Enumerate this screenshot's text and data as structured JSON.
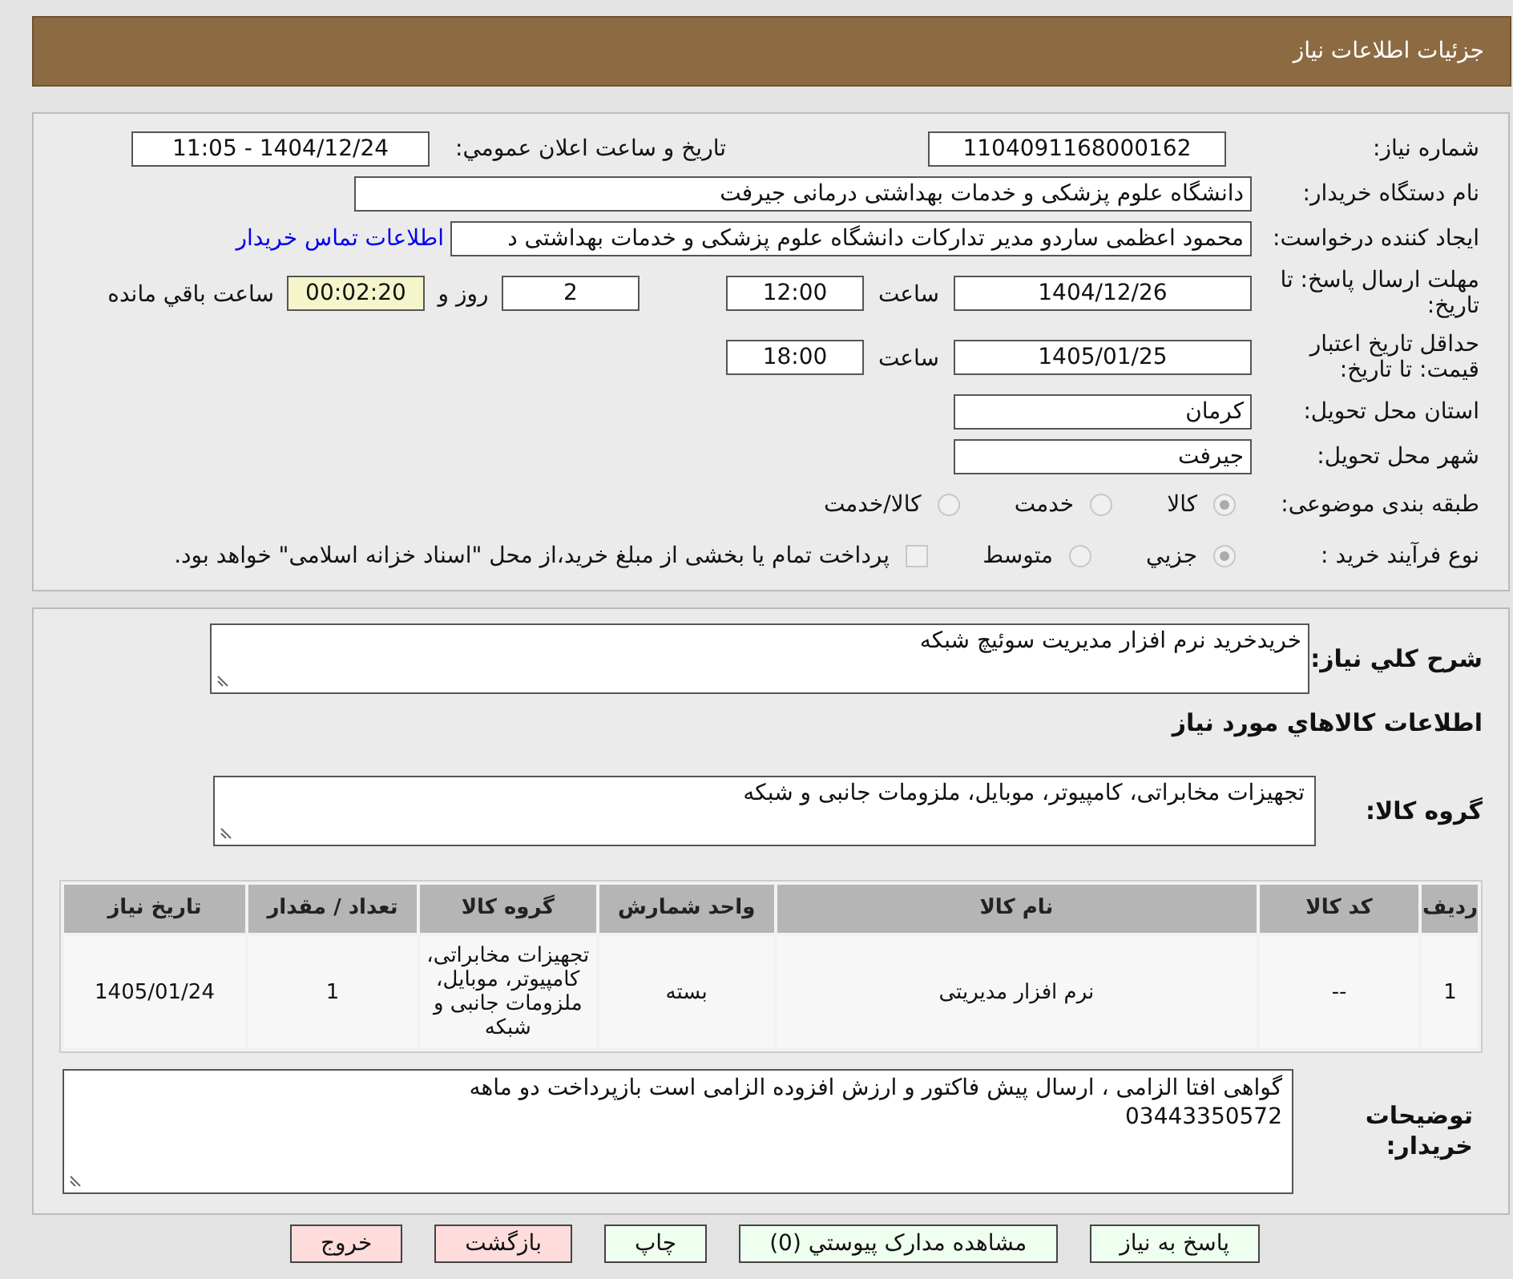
{
  "header": {
    "title": "جزئیات اطلاعات نیاز"
  },
  "need_number": {
    "label": "شماره نیاز:",
    "value": "1104091168000162"
  },
  "announce": {
    "label": "تاریخ و ساعت اعلان عمومي:",
    "value": "1404/12/24 - 11:05"
  },
  "buyer": {
    "label": "نام دستگاه خریدار:",
    "value": "دانشگاه علوم پزشکی و خدمات بهداشتی درمانی جیرفت"
  },
  "creator": {
    "label": "ایجاد کننده درخواست:",
    "value": "محمود اعظمی ساردو مدیر تدارکات دانشگاه علوم پزشکی و خدمات بهداشتی د",
    "link": "اطلاعات تماس خریدار"
  },
  "deadline": {
    "label": "مهلت ارسال پاسخ: تا تاریخ:",
    "date": "1404/12/26",
    "time_label": "ساعت",
    "time": "12:00",
    "days": "2",
    "days_label": "روز و",
    "remaining": "00:02:20",
    "remaining_label": "ساعت باقي مانده"
  },
  "validity": {
    "label": "حداقل تاریخ اعتبار قیمت: تا تاریخ:",
    "date": "1405/01/25",
    "time_label": "ساعت",
    "time": "18:00"
  },
  "province": {
    "label": "استان محل تحویل:",
    "value": "کرمان"
  },
  "city": {
    "label": "شهر محل تحویل:",
    "value": "جیرفت"
  },
  "category": {
    "label": "طبقه بندی موضوعی:",
    "options": [
      {
        "label": "کالا",
        "selected": true,
        "disabled": true
      },
      {
        "label": "خدمت",
        "selected": false,
        "disabled": true
      },
      {
        "label": "کالا/خدمت",
        "selected": false,
        "disabled": true
      }
    ]
  },
  "process": {
    "label": "نوع فرآیند خرید :",
    "options": [
      {
        "label": "جزيي",
        "selected": true,
        "disabled": true
      },
      {
        "label": "متوسط",
        "selected": false,
        "disabled": true
      }
    ],
    "treasury": {
      "label": "پرداخت تمام یا بخشی از مبلغ خرید،از محل \"اسناد خزانه اسلامی\" خواهد بود.",
      "checked": false
    }
  },
  "summary": {
    "label": "شرح کلي نياز:",
    "value": "خریدخرید نرم افزار مدیریت سوئیچ شبکه"
  },
  "goods_heading": "اطلاعات کالاهاي مورد نياز",
  "goods_group": {
    "label": "گروه کالا:",
    "value": "تجهیزات مخابراتی، کامپیوتر، موبایل، ملزومات جانبی و شبکه"
  },
  "table": {
    "columns": [
      "ردیف",
      "کد کالا",
      "نام کالا",
      "واحد شمارش",
      "گروه کالا",
      "تعداد / مقدار",
      "تاریخ نیاز"
    ],
    "rows": [
      [
        "1",
        "--",
        "نرم افزار مدیریتی",
        "بسته",
        "تجهیزات مخابراتی، کامپیوتر، موبایل، ملزومات جانبی و شبکه",
        "1",
        "1405/01/24"
      ]
    ]
  },
  "notes": {
    "label": "توضیحات خریدار:",
    "lines": [
      "گواهی افتا الزامی ، ارسال پیش فاکتور و ارزش افزوده الزامی است بازپرداخت دو ماهه",
      "03443350572"
    ]
  },
  "buttons": [
    {
      "label": "پاسخ به نیاز",
      "kind": "primary"
    },
    {
      "label": "مشاهده مدارک پیوستي (0)",
      "kind": "primary"
    },
    {
      "label": "چاپ",
      "kind": "primary"
    },
    {
      "label": "بازگشت",
      "kind": "danger"
    },
    {
      "label": "خروج",
      "kind": "danger"
    }
  ]
}
